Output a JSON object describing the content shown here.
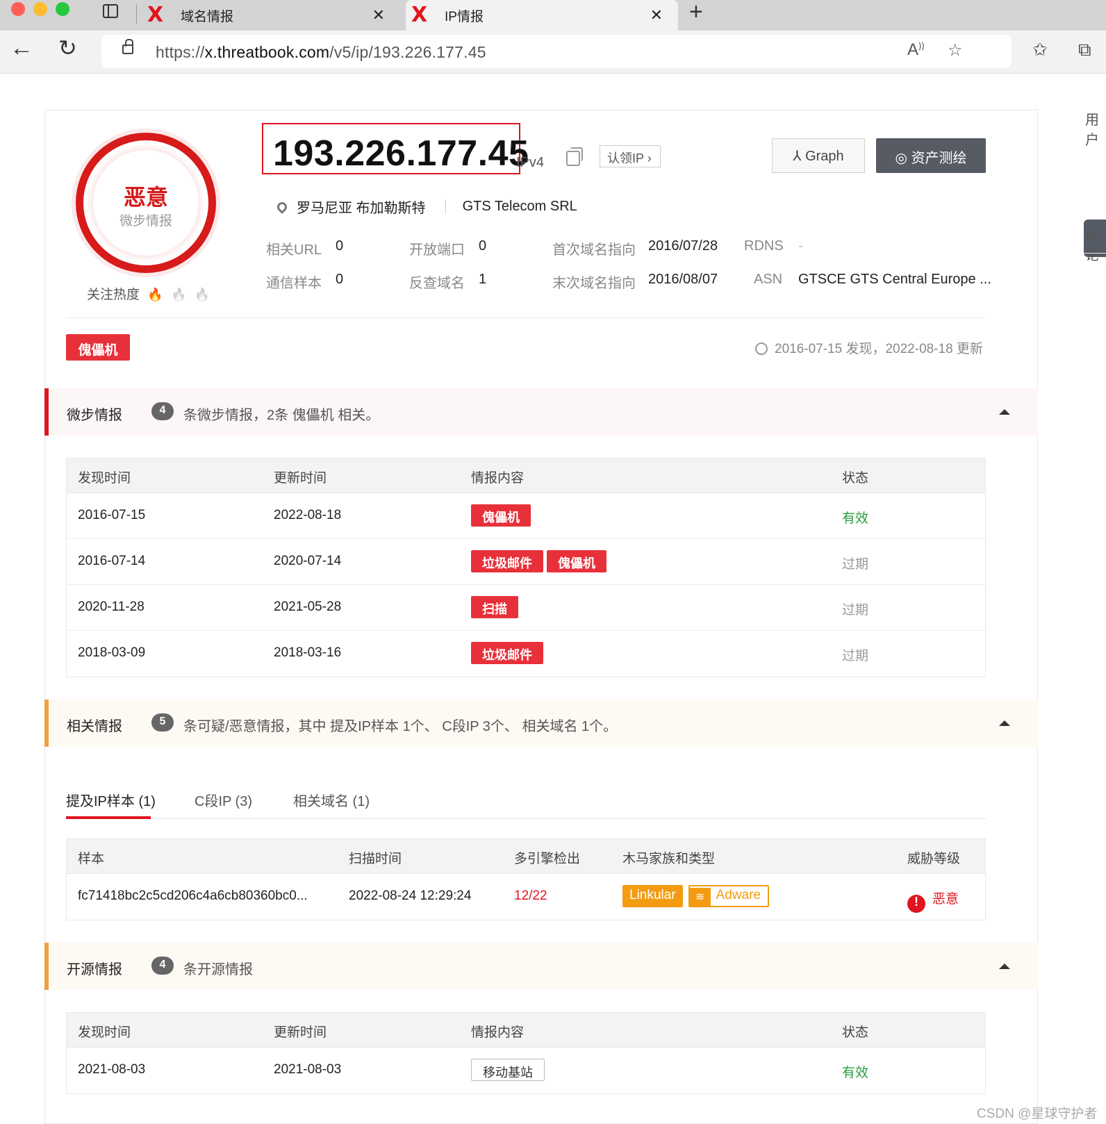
{
  "browser": {
    "tabs": [
      {
        "title": "域名情报",
        "logo": "X"
      },
      {
        "title": "IP情报",
        "logo": "X"
      }
    ],
    "url_prefix": "https://",
    "url_host": "x.threatbook.com",
    "url_path": "/v5/ip/193.226.177.45"
  },
  "sidebar_right": {
    "label_top": "用户",
    "label_mid": "评论"
  },
  "overview": {
    "verdict": "恶意",
    "verdict_source": "微步情报",
    "heat_label": "关注热度",
    "ip": "193.226.177.45",
    "ip_type": "IPv4",
    "claim_label": "认领IP",
    "graph_label": "Graph",
    "asset_label": "资产测绘",
    "location": "罗马尼亚 布加勒斯特",
    "isp": "GTS Telecom SRL",
    "stats": [
      {
        "key": "相关URL",
        "value": "0"
      },
      {
        "key": "开放端口",
        "value": "0"
      },
      {
        "key": "首次域名指向",
        "value": "2016/07/28"
      },
      {
        "key": "RDNS",
        "value": "-"
      },
      {
        "key": "通信样本",
        "value": "0"
      },
      {
        "key": "反查域名",
        "value": "1"
      },
      {
        "key": "末次域名指向",
        "value": "2016/08/07"
      },
      {
        "key": "ASN",
        "value": "GTSCE GTS Central Europe ..."
      }
    ],
    "tag": "傀儡机",
    "discover_text": "2016-07-15 发现，2022-08-18 更新"
  },
  "threatbook_intel": {
    "title": "微步情报",
    "count": "4",
    "desc": "条微步情报，2条 傀儡机 相关。",
    "columns": [
      "发现时间",
      "更新时间",
      "情报内容",
      "状态"
    ],
    "rows": [
      {
        "found": "2016-07-15",
        "updated": "2022-08-18",
        "tags": [
          "傀儡机"
        ],
        "status": "有效"
      },
      {
        "found": "2016-07-14",
        "updated": "2020-07-14",
        "tags": [
          "垃圾邮件",
          "傀儡机"
        ],
        "status": "过期"
      },
      {
        "found": "2020-11-28",
        "updated": "2021-05-28",
        "tags": [
          "扫描"
        ],
        "status": "过期"
      },
      {
        "found": "2018-03-09",
        "updated": "2018-03-16",
        "tags": [
          "垃圾邮件"
        ],
        "status": "过期"
      }
    ]
  },
  "related_intel": {
    "title": "相关情报",
    "count": "5",
    "desc": "条可疑/恶意情报，其中 提及IP样本 1个、 C段IP 3个、 相关域名 1个。",
    "subtabs": [
      "提及IP样本 (1)",
      "C段IP (3)",
      "相关域名 (1)"
    ],
    "columns": [
      "样本",
      "扫描时间",
      "多引擎检出",
      "木马家族和类型",
      "威胁等级"
    ],
    "rows": [
      {
        "sample": "fc71418bc2c5cd206c4a6cb80360bc0...",
        "scan_time": "2022-08-24 12:29:24",
        "detect": "12/22",
        "family": "Linkular",
        "type": "Adware",
        "level": "恶意"
      }
    ]
  },
  "open_intel": {
    "title": "开源情报",
    "count": "4",
    "desc": "条开源情报",
    "columns": [
      "发现时间",
      "更新时间",
      "情报内容",
      "状态"
    ],
    "rows": [
      {
        "found": "2021-08-03",
        "updated": "2021-08-03",
        "content": "移动基站",
        "status": "有效"
      }
    ]
  },
  "watermark": "CSDN @星球守护者"
}
